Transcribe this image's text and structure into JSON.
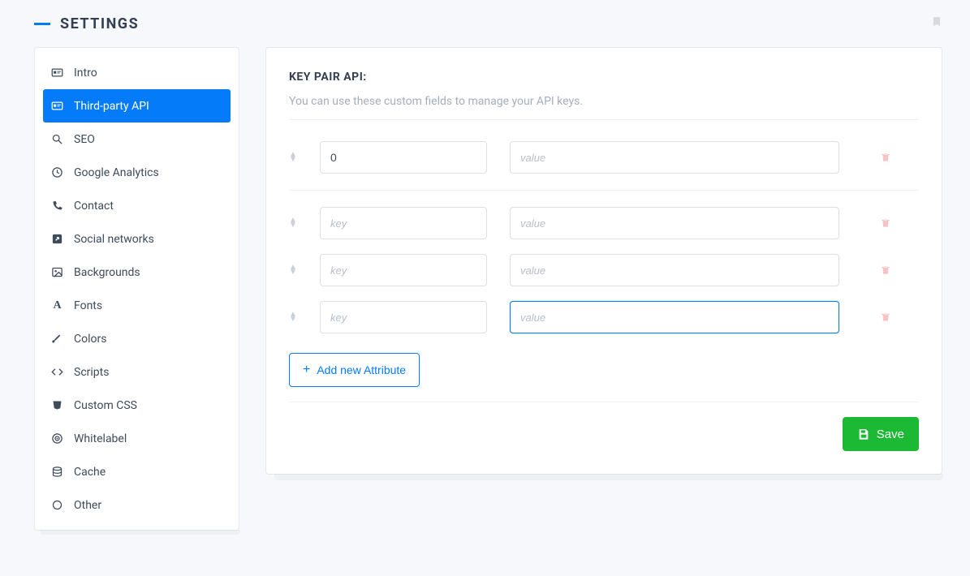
{
  "header": {
    "title": "SETTINGS"
  },
  "sidebar": {
    "items": [
      {
        "label": "Intro"
      },
      {
        "label": "Third-party API"
      },
      {
        "label": "SEO"
      },
      {
        "label": "Google Analytics"
      },
      {
        "label": "Contact"
      },
      {
        "label": "Social networks"
      },
      {
        "label": "Backgrounds"
      },
      {
        "label": "Fonts"
      },
      {
        "label": "Colors"
      },
      {
        "label": "Scripts"
      },
      {
        "label": "Custom CSS"
      },
      {
        "label": "Whitelabel"
      },
      {
        "label": "Cache"
      },
      {
        "label": "Other"
      }
    ],
    "active_index": 1
  },
  "section": {
    "title": "KEY PAIR API:",
    "subtitle": "You can use these custom fields to manage your API keys.",
    "key_placeholder": "key",
    "value_placeholder": "value",
    "rows": [
      {
        "key": "0",
        "value": ""
      },
      {
        "key": "",
        "value": ""
      },
      {
        "key": "",
        "value": ""
      },
      {
        "key": "",
        "value": ""
      }
    ],
    "focused_row_index": 3,
    "focused_field": "value"
  },
  "buttons": {
    "add": "Add new Attribute",
    "save": "Save"
  }
}
